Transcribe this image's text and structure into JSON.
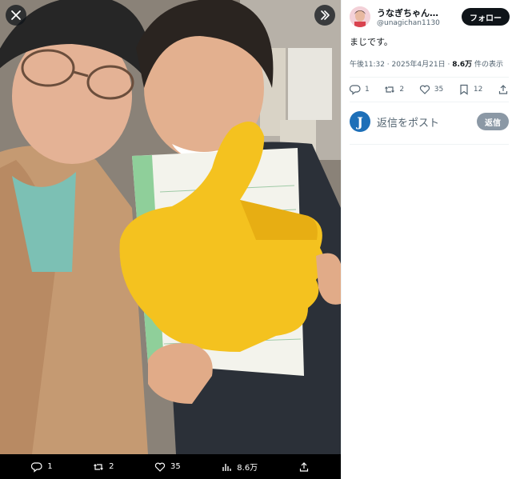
{
  "media": {
    "actions": {
      "reply_count": "1",
      "repost_count": "2",
      "like_count": "35",
      "views_count": "8.6万"
    }
  },
  "post": {
    "display_name": "うなぎちゃん（...",
    "handle": "@unagichan1130",
    "follow_label": "フォロー",
    "text": "まじです。",
    "time": "午後11:32 · 2025年4月21日 · ",
    "views_value": "8.6万",
    "views_suffix": " 件の表示",
    "actions": {
      "reply_count": "1",
      "repost_count": "2",
      "like_count": "35",
      "bookmark_count": "12"
    },
    "reply_placeholder": "返信をポスト",
    "reply_avatar_letter": "J",
    "reply_button": "返信"
  },
  "colors": {
    "follow_bg": "#0f1419",
    "reply_btn_bg": "#8b98a5",
    "muted_text": "#536471",
    "media_bar_bg": "#000000"
  }
}
